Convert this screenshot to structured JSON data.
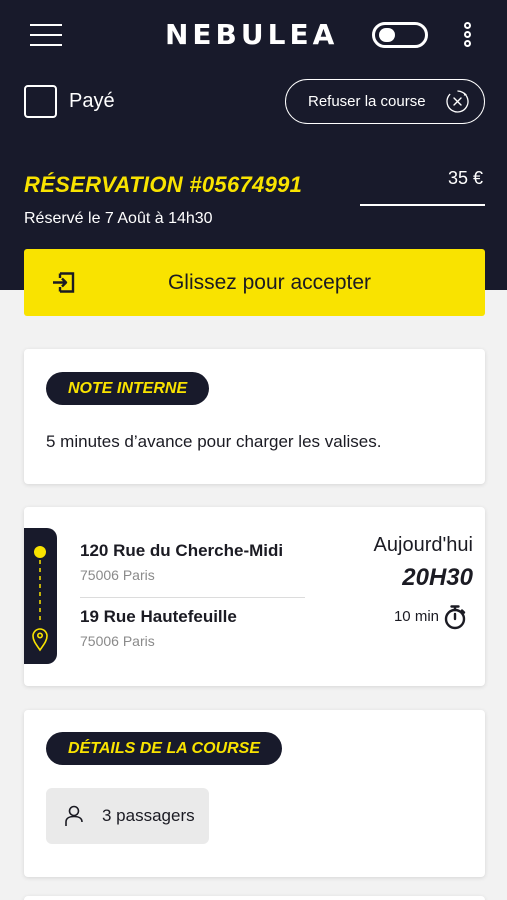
{
  "header": {
    "brand": "NEBULEA",
    "menu_icon": "hamburger-menu-icon",
    "toggle_state": "off",
    "more_icon": "vertical-dots-icon",
    "background_color": "#181a2b",
    "accent_color": "#f9e300"
  },
  "paid": {
    "label": "Payé",
    "checked": false
  },
  "refuse": {
    "label": "Refuser la course",
    "icon": "close-circle-icon"
  },
  "reservation": {
    "title": "RÉSERVATION #05674991",
    "booked": "Réservé le 7 Août à 14h30",
    "price": "35 €"
  },
  "accept_slider": {
    "label": "Glissez pour accepter",
    "icon": "arrow-into-box-icon"
  },
  "note": {
    "badge": "NOTE INTERNE",
    "text": "5 minutes d’avance pour charger les valises."
  },
  "trip": {
    "pickup": {
      "street": "120 Rue du Cherche-Midi",
      "city": "75006 Paris"
    },
    "dropoff": {
      "street": "19 Rue Hautefeuille",
      "city": "75006 Paris"
    },
    "day": "Aujourd'hui",
    "time": "20H30",
    "duration": "10 min",
    "duration_icon": "stopwatch-icon"
  },
  "details": {
    "badge": "DÉTAILS DE LA COURSE",
    "passengers": "3 passagers",
    "passenger_icon": "person-icon"
  }
}
